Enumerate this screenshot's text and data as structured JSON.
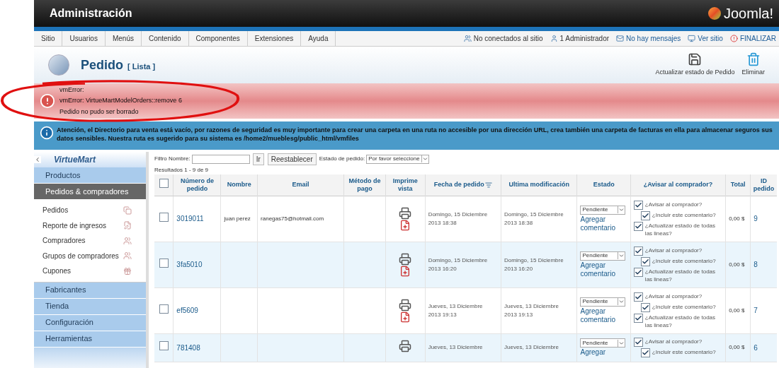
{
  "header": {
    "title": "Administración",
    "logo_text": "Joomla!"
  },
  "menu": [
    "Sitio",
    "Usuarios",
    "Menús",
    "Contenido",
    "Componentes",
    "Extensiones",
    "Ayuda"
  ],
  "status": [
    "No conectados al sitio",
    "1 Administrador",
    "No hay mensajes",
    "Ver sitio",
    "FINALIZAR"
  ],
  "page": {
    "title": "Pedido",
    "subtitle": "[ Lista ]"
  },
  "toolbar": [
    "Actualizar estado de Pedido",
    "Eliminar"
  ],
  "error": [
    "vmError:",
    "vmError: VirtueMartModelOrders::remove 6",
    "Pedido no pudo ser borrado"
  ],
  "info": "Atención, el Directorio para venta está vacío, por razones de seguridad es muy importante para crear una carpeta en una ruta no accesible por una dirección URL, crea también una carpeta de facturas en ella para almacenar seguros sus datos sensibles. Nuestra ruta es sugerido para su sistema es /home2/mueblesg/public_html/vmfiles",
  "sidebar": {
    "logo": "VirtueMart",
    "sections": [
      {
        "label": "Productos",
        "selected": false
      },
      {
        "label": "Pedidos & compradores",
        "selected": true,
        "children": [
          "Pedidos",
          "Reporte de ingresos",
          "Compradores",
          "Grupos de compradores",
          "Cupones"
        ]
      },
      {
        "label": "Fabricantes",
        "selected": false
      },
      {
        "label": "Tienda",
        "selected": false
      },
      {
        "label": "Configuración",
        "selected": false
      },
      {
        "label": "Herramientas",
        "selected": false
      }
    ]
  },
  "select_all": {
    "checked": false
  },
  "filter": {
    "label": "Filtro Nombre:",
    "go": "Ir",
    "reset": "Reestablecer",
    "status_label": "Estado de pedido:",
    "status_value": "Por favor seleccione",
    "results": "Resultados 1 - 9 de 9"
  },
  "columns": [
    {
      "label": "Número de pedido",
      "sorted": false
    },
    {
      "label": "Nombre",
      "sorted": false
    },
    {
      "label": "Email",
      "sorted": false
    },
    {
      "label": "Método de pago",
      "sorted": false
    },
    {
      "label": "Imprime vista",
      "sorted": false
    },
    {
      "label": "Fecha de pedido",
      "sorted": true
    },
    {
      "label": "Ultima modificación",
      "sorted": false
    },
    {
      "label": "Estado",
      "sorted": false
    },
    {
      "label": "¿Avisar al comprador?",
      "sorted": false
    },
    {
      "label": "Total",
      "sorted": false
    },
    {
      "label": "ID pedido",
      "sorted": false
    }
  ],
  "rows": [
    {
      "checked": false,
      "number": "3019011",
      "name": "juan perez",
      "email": "ranegas75@hotmail.com",
      "order_date": [
        "Domingo, 15 Diciembre",
        "2013 18:38"
      ],
      "modified": [
        "Domingo, 15 Diciembre",
        "2013 18:38"
      ],
      "status": "Pendiente",
      "comment": "Agregar comentario",
      "notify": [
        {
          "label": "¿Avisar al comprador?",
          "checked": true
        },
        {
          "label": "¿Incluir este comentario?",
          "checked": true
        },
        {
          "label": "¿Actualizar estado de todas las lineas?",
          "checked": true
        }
      ],
      "total": "0,00 $",
      "id": "9"
    },
    {
      "checked": false,
      "number": "3fa5010",
      "name": "",
      "email": "",
      "order_date": [
        "Domingo, 15 Diciembre",
        "2013 16:20"
      ],
      "modified": [
        "Domingo, 15 Diciembre",
        "2013 16:20"
      ],
      "status": "Pendiente",
      "comment": "Agregar comentario",
      "notify": [
        {
          "label": "¿Avisar al comprador?",
          "checked": true
        },
        {
          "label": "¿Incluir este comentario?",
          "checked": true
        },
        {
          "label": "¿Actualizar estado de todas las lineas?",
          "checked": true
        }
      ],
      "total": "0,00 $",
      "id": "8"
    },
    {
      "checked": false,
      "number": "ef5609",
      "name": "",
      "email": "",
      "order_date": [
        "Jueves, 13 Diciembre",
        "2013 19:13"
      ],
      "modified": [
        "Jueves, 13 Diciembre",
        "2013 19:13"
      ],
      "status": "Pendiente",
      "comment": "Agregar comentario",
      "notify": [
        {
          "label": "¿Avisar al comprador?",
          "checked": true
        },
        {
          "label": "¿Incluir este comentario?",
          "checked": true
        },
        {
          "label": "¿Actualizar estado de todas las lineas?",
          "checked": true
        }
      ],
      "total": "0,00 $",
      "id": "7"
    },
    {
      "checked": false,
      "number": "781408",
      "name": "",
      "email": "",
      "order_date": [
        "Jueves, 13 Diciembre"
      ],
      "modified": [
        "Jueves, 13 Diciembre"
      ],
      "status": "Pendiente",
      "comment": "Agregar",
      "notify": [
        {
          "label": "¿Avisar al comprador?",
          "checked": true
        },
        {
          "label": "¿Incluir este comentario?",
          "checked": true
        }
      ],
      "total": "0,00 $",
      "id": "6"
    }
  ]
}
